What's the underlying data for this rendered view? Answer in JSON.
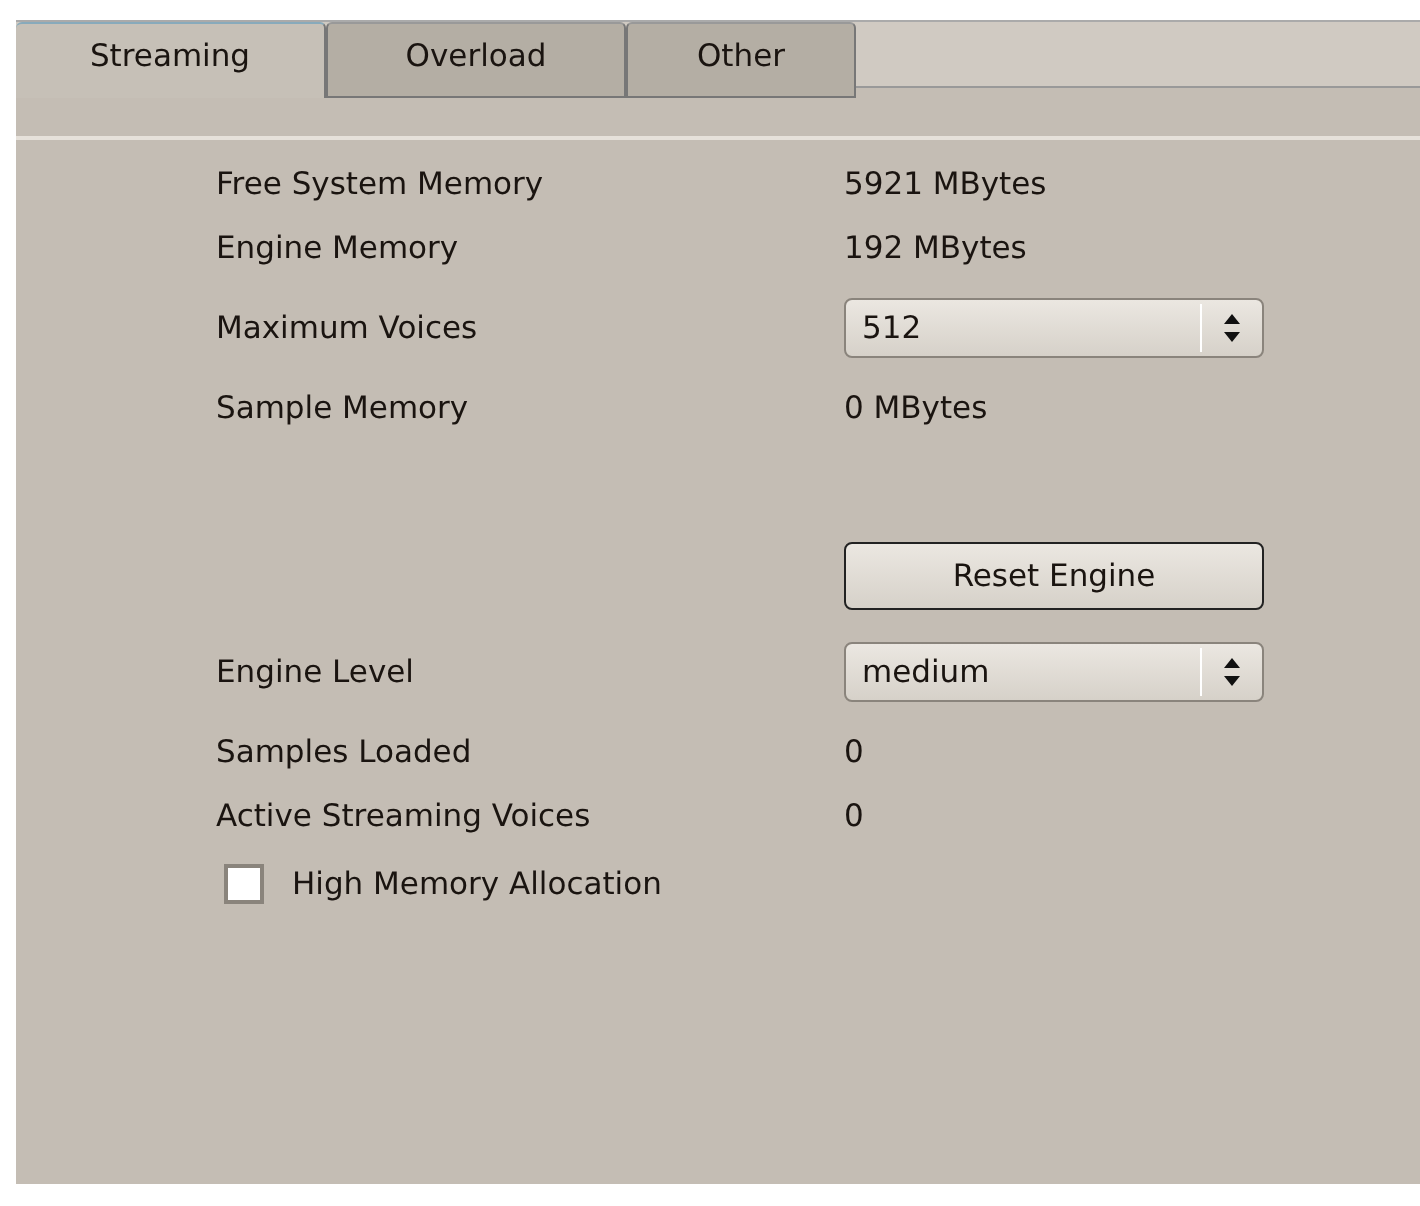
{
  "tabs": [
    {
      "label": "Streaming",
      "selected": true
    },
    {
      "label": "Overload",
      "selected": false
    },
    {
      "label": "Other",
      "selected": false
    }
  ],
  "rows": [
    {
      "kind": "text",
      "label": "Free System Memory",
      "value": "5921 MBytes"
    },
    {
      "kind": "text",
      "label": "Engine Memory",
      "value": "192 MBytes"
    },
    {
      "kind": "select",
      "label": "Maximum Voices",
      "value": "512"
    },
    {
      "kind": "text",
      "label": "Sample Memory",
      "value": "0 MBytes"
    },
    {
      "kind": "button",
      "value": "Reset Engine"
    },
    {
      "kind": "select",
      "label": "Engine Level",
      "value": "medium"
    },
    {
      "kind": "text",
      "label": "Samples Loaded",
      "value": "0"
    },
    {
      "kind": "text",
      "label": "Active Streaming Voices",
      "value": "0"
    },
    {
      "kind": "checkbox",
      "label": "High Memory Allocation",
      "checked": false
    }
  ]
}
